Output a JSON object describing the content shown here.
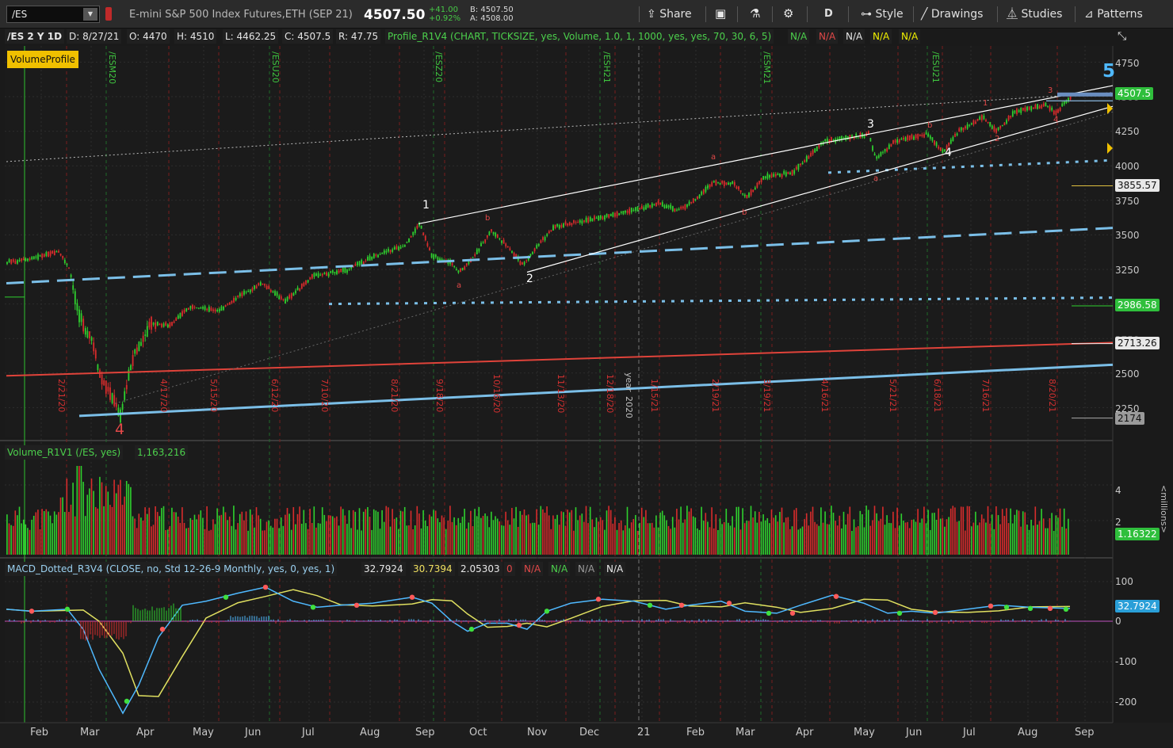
{
  "toolbar": {
    "symbol": "/ES",
    "description": "E-mini S&P 500 Index Futures,ETH (SEP 21)",
    "last": "4507.50",
    "change": "+41.00",
    "change_pct": "+0.92%",
    "bid": "B: 4507.50",
    "ask": "A: 4508.00",
    "share": "Share",
    "period": "D",
    "style": "Style",
    "drawings": "Drawings",
    "studies": "Studies",
    "patterns": "Patterns"
  },
  "header": {
    "symbol_period": "/ES 2 Y 1D",
    "date": "D: 8/27/21",
    "open": "O: 4470",
    "high": "H: 4510",
    "low": "L: 4462.25",
    "close": "C: 4507.5",
    "range": "R: 47.75",
    "study": "Profile_R1V4 (CHART, TICKSIZE, yes, Volume, 1.0, 1, 1000, yes, yes, 70, 30, 6, 5)",
    "na": [
      "N/A",
      "N/A",
      "N/A",
      "N/A",
      "N/A"
    ]
  },
  "volume_profile_label": "VolumeProfile",
  "price_axis": [
    "4750",
    "4500",
    "4250",
    "4000",
    "3750",
    "3500",
    "3250",
    "2750",
    "2500",
    "2250"
  ],
  "price_tags": [
    {
      "text": "4507.5",
      "bg": "#2fbf3c",
      "color": "#ffffff"
    },
    {
      "text": "3855.57",
      "bg": "#e8e8e8",
      "color": "#111111"
    },
    {
      "text": "2986.58",
      "bg": "#2fbf3c",
      "color": "#ffffff"
    },
    {
      "text": "2713.26",
      "bg": "#e8e8e8",
      "color": "#111111"
    },
    {
      "text": "2174",
      "bg": "#9a9a9a",
      "color": "#111111"
    }
  ],
  "wave_labels": {
    "w4_start": "4",
    "w1": "1",
    "w2": "2",
    "w3": "3",
    "w4": "4",
    "w5": "5",
    "a1": "a",
    "b1": "b",
    "a2": "a",
    "a3": "a",
    "b2": "b",
    "a4": "a",
    "b3": "b",
    "s1": "1",
    "s2": "2",
    "s3": "3",
    "s4": "4"
  },
  "expiry_labels": [
    "/ESM20",
    "/ESU20",
    "/ESZ20",
    "/ESH21",
    "/ESM21",
    "/ESU21"
  ],
  "date_labels": [
    "2/21/20",
    "4/17/20",
    "5/15/20",
    "6/12/20",
    "7/10/20",
    "8/21/20",
    "9/18/20",
    "10/16/20",
    "11/13/20",
    "12/18/20",
    "2020",
    "year",
    "1/15/21",
    "2/19/21",
    "3/19/21",
    "4/16/21",
    "5/21/21",
    "6/18/21",
    "7/16/21",
    "8/20/21"
  ],
  "volume_panel": {
    "label": "Volume_R1V1 (/ES, yes)",
    "value": "1,163,216",
    "axis": [
      "4",
      "2"
    ],
    "unit": "<millions>",
    "tag": "1.16322"
  },
  "macd_panel": {
    "label": "MACD_Dotted_R3V4 (CLOSE, no, Std 12-26-9 Monthly, yes, 0, yes, 1)",
    "v1": "32.7924",
    "v2": "30.7394",
    "v3": "2.05303",
    "v4": "0",
    "na": [
      "N/A",
      "N/A",
      "N/A",
      "N/A"
    ],
    "axis": [
      "100",
      "0",
      "-100",
      "-200"
    ],
    "tag": "32.7924"
  },
  "months": [
    "Feb",
    "Mar",
    "Apr",
    "May",
    "Jun",
    "Jul",
    "Aug",
    "Sep",
    "Oct",
    "Nov",
    "Dec",
    "21",
    "Feb",
    "Mar",
    "Apr",
    "May",
    "Jun",
    "Jul",
    "Aug",
    "Sep"
  ],
  "colors": {
    "up": "#2fd02f",
    "down": "#d82c2c",
    "channel": "#ffffff",
    "trend_blue": "#7bbfe8",
    "trend_red": "#e0433a",
    "accent_yellow": "#f0c000"
  }
}
